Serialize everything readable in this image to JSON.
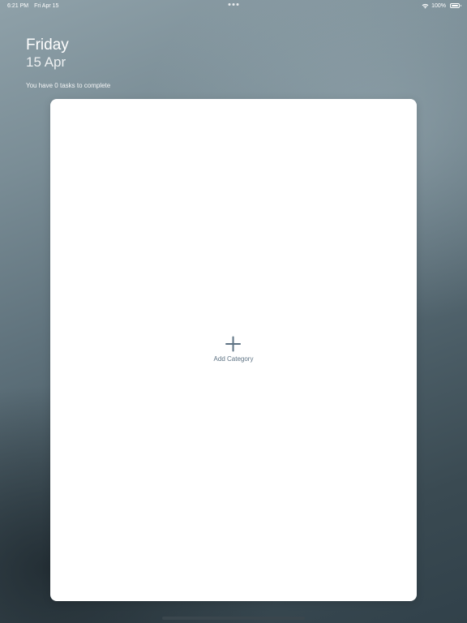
{
  "status_bar": {
    "time": "6:21 PM",
    "date": "Fri Apr 15",
    "battery_percent": "100%",
    "wifi_icon": "wifi-icon",
    "battery_icon": "battery-icon",
    "multitask_icon": "more-dots-icon"
  },
  "header": {
    "day_name": "Friday",
    "date": "15 Apr",
    "tasks_summary": "You have 0 tasks to complete"
  },
  "card": {
    "add_category_icon": "plus-icon",
    "add_category_label": "Add Category"
  },
  "colors": {
    "accent": "#5d7283",
    "card_background": "#ffffff"
  }
}
